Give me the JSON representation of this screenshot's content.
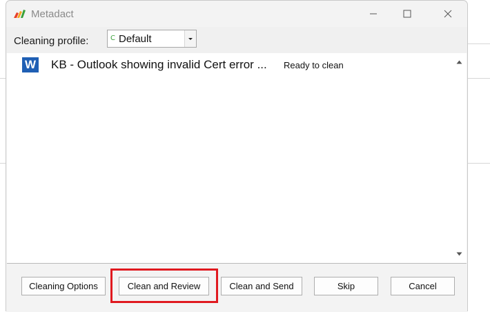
{
  "window": {
    "title": "Metadact",
    "controls": {
      "minimize": "minimize-icon",
      "maximize": "maximize-icon",
      "close": "close-icon"
    }
  },
  "toolbar": {
    "profile_label": "Cleaning profile:",
    "profile_value": "Default",
    "profile_icon_glyph": "C"
  },
  "documents": [
    {
      "icon": "word-doc-icon",
      "icon_letter": "W",
      "name": "KB - Outlook showing invalid Cert error ...",
      "status": "Ready to clean"
    }
  ],
  "buttons": {
    "cleaning_options": "Cleaning Options",
    "clean_and_review": "Clean and Review",
    "clean_and_send": "Clean and Send",
    "skip": "Skip",
    "cancel": "Cancel"
  },
  "colors": {
    "highlight": "#e0191f",
    "word_blue": "#1f5fb4",
    "logo_red": "#e8412a",
    "logo_orange": "#f5a623",
    "logo_green": "#3aa13a"
  }
}
